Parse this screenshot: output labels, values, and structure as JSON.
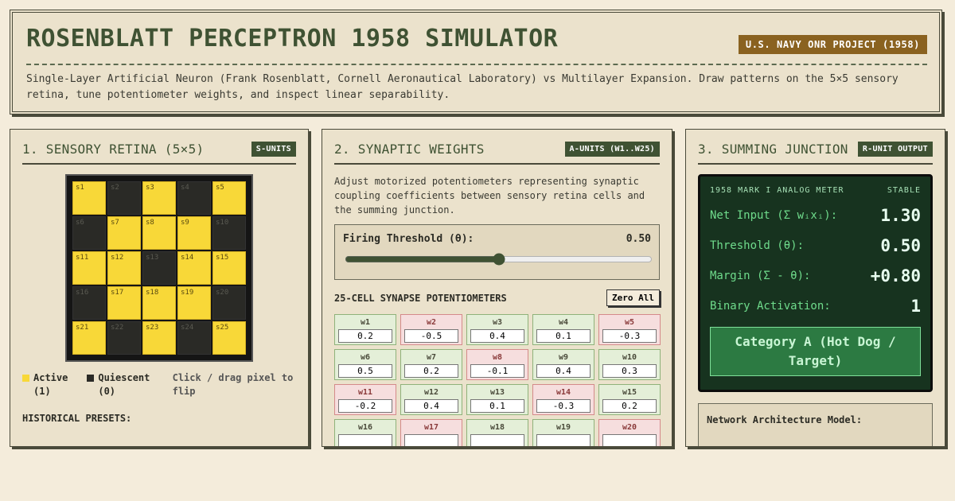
{
  "header": {
    "title": "ROSENBLATT PERCEPTRON 1958 SIMULATOR",
    "badge": "U.S. NAVY ONR PROJECT (1958)",
    "subtitle": "Single-Layer Artificial Neuron (Frank Rosenblatt, Cornell Aeronautical Laboratory) vs Multilayer Expansion. Draw patterns on the 5×5 sensory retina, tune potentiometer weights, and inspect linear separability."
  },
  "retina_panel": {
    "title": "1. SENSORY RETINA (5×5)",
    "badge": "S-UNITS",
    "pixels": [
      {
        "label": "s1",
        "active": true
      },
      {
        "label": "s2",
        "active": false
      },
      {
        "label": "s3",
        "active": true
      },
      {
        "label": "s4",
        "active": false
      },
      {
        "label": "s5",
        "active": true
      },
      {
        "label": "s6",
        "active": false
      },
      {
        "label": "s7",
        "active": true
      },
      {
        "label": "s8",
        "active": true
      },
      {
        "label": "s9",
        "active": true
      },
      {
        "label": "s10",
        "active": false
      },
      {
        "label": "s11",
        "active": true
      },
      {
        "label": "s12",
        "active": true
      },
      {
        "label": "s13",
        "active": false
      },
      {
        "label": "s14",
        "active": true
      },
      {
        "label": "s15",
        "active": true
      },
      {
        "label": "s16",
        "active": false
      },
      {
        "label": "s17",
        "active": true
      },
      {
        "label": "s18",
        "active": true
      },
      {
        "label": "s19",
        "active": true
      },
      {
        "label": "s20",
        "active": false
      },
      {
        "label": "s21",
        "active": true
      },
      {
        "label": "s22",
        "active": false
      },
      {
        "label": "s23",
        "active": true
      },
      {
        "label": "s24",
        "active": false
      },
      {
        "label": "s25",
        "active": true
      }
    ],
    "legend_active": "Active (1)",
    "legend_quiescent": "Quiescent (0)",
    "hint": "Click / drag pixel to flip",
    "presets_label": "HISTORICAL PRESETS:",
    "colors": {
      "active": "#f8d838",
      "quiescent": "#2a2a26"
    }
  },
  "weights_panel": {
    "title": "2. SYNAPTIC WEIGHTS",
    "badge": "A-UNITS (W1..W25)",
    "description": "Adjust motorized potentiometers representing synaptic coupling coefficients between sensory retina cells and the summing junction.",
    "threshold_label": "Firing Threshold (θ):",
    "threshold_value": "0.50",
    "threshold_slider": {
      "min": 0,
      "max": 1,
      "step": 0.01,
      "value": 0.5
    },
    "synapse_heading": "25-CELL SYNAPSE POTENTIOMETERS",
    "zero_label": "Zero All",
    "weights": [
      {
        "label": "w1",
        "value": "0.2"
      },
      {
        "label": "w2",
        "value": "-0.5"
      },
      {
        "label": "w3",
        "value": "0.4"
      },
      {
        "label": "w4",
        "value": "0.1"
      },
      {
        "label": "w5",
        "value": "-0.3"
      },
      {
        "label": "w6",
        "value": "0.5"
      },
      {
        "label": "w7",
        "value": "0.2"
      },
      {
        "label": "w8",
        "value": "-0.1"
      },
      {
        "label": "w9",
        "value": "0.4"
      },
      {
        "label": "w10",
        "value": "0.3"
      },
      {
        "label": "w11",
        "value": "-0.2"
      },
      {
        "label": "w12",
        "value": "0.4"
      },
      {
        "label": "w13",
        "value": "0.1"
      },
      {
        "label": "w14",
        "value": "-0.3"
      },
      {
        "label": "w15",
        "value": "0.2"
      },
      {
        "label": "w16",
        "value": ""
      },
      {
        "label": "w17",
        "value": ""
      },
      {
        "label": "w18",
        "value": ""
      },
      {
        "label": "w19",
        "value": ""
      },
      {
        "label": "w20",
        "value": ""
      }
    ],
    "negative_cells": [
      "w2",
      "w5",
      "w8",
      "w11",
      "w14",
      "w17",
      "w20"
    ]
  },
  "junction_panel": {
    "title": "3. SUMMING JUNCTION",
    "badge": "R-UNIT OUTPUT",
    "meter_caption": "1958 MARK I ANALOG METER",
    "meter_status": "STABLE",
    "net_input_label": "Net Input (Σ wᵢxᵢ):",
    "net_input_value": "1.30",
    "threshold_label": "Threshold (θ):",
    "threshold_value": "0.50",
    "margin_label": "Margin (Σ - θ):",
    "margin_value": "+0.80",
    "activation_label": "Binary Activation:",
    "activation_value": "1",
    "category": "Category A (Hot Dog / Target)",
    "architecture_label": "Network Architecture Model:"
  }
}
